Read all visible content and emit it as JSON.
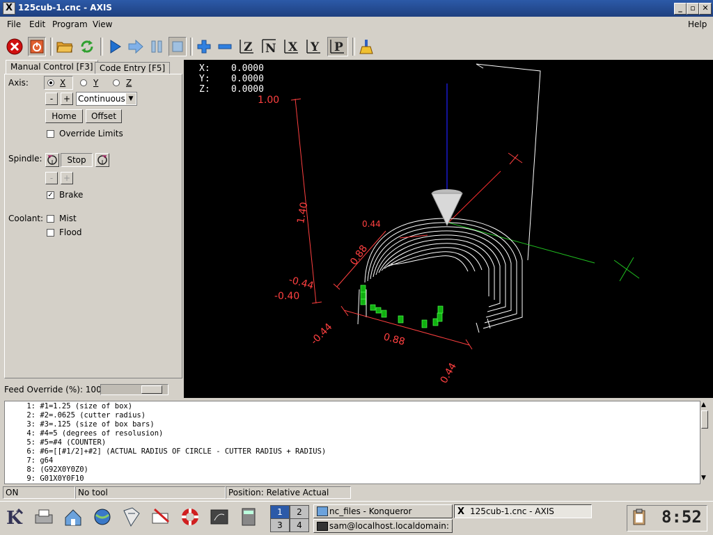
{
  "window": {
    "title": "125cub-1.cnc - AXIS",
    "app_icon": "X"
  },
  "menu": {
    "file": "File",
    "edit": "Edit",
    "program": "Program",
    "view": "View",
    "help": "Help"
  },
  "tabs": {
    "manual": "Manual Control [F3]",
    "code_entry": "Code Entry [F5]"
  },
  "manual": {
    "axis_label": "Axis:",
    "axis_x": "X",
    "axis_y": "Y",
    "axis_z": "Z",
    "minus": "-",
    "plus": "+",
    "jog_mode": "Continuous",
    "home": "Home",
    "offset": "Offset",
    "override_limits": "Override Limits",
    "spindle_label": "Spindle:",
    "stop": "Stop",
    "brake": "Brake",
    "coolant_label": "Coolant:",
    "mist": "Mist",
    "flood": "Flood"
  },
  "feed_override": {
    "label": "Feed Override (%): 100",
    "value": 100
  },
  "dro": {
    "x_label": "X:",
    "x": "0.0000",
    "y_label": "Y:",
    "y": "0.0000",
    "z_label": "Z:",
    "z": "0.0000"
  },
  "dims": {
    "d100": "1.00",
    "d140": "1.40",
    "d044a": "0.44",
    "d088a": "0.88",
    "dm044a": "-0.44",
    "dm040": "-0.40",
    "dm044b": "-0.44",
    "d088b": "0.88",
    "d044b": "0.44",
    "axis_y": "Y"
  },
  "code_lines": [
    {
      "n": "1:",
      "t": "#1=1.25 (size of box)"
    },
    {
      "n": "2:",
      "t": "#2=.0625 (cutter radius)"
    },
    {
      "n": "3:",
      "t": "#3=.125 (size of box bars)"
    },
    {
      "n": "4:",
      "t": "#4=5 (degrees of resolusion)"
    },
    {
      "n": "5:",
      "t": "#5=#4 (COUNTER)"
    },
    {
      "n": "6:",
      "t": "#6=[[#1/2]+#2] (ACTUAL RADIUS OF CIRCLE - CUTTER RADIUS + RADIUS)"
    },
    {
      "n": "7:",
      "t": "g64"
    },
    {
      "n": "8:",
      "t": "(G92X0Y0Z0)"
    },
    {
      "n": "9:",
      "t": "G01X0Y0F10"
    }
  ],
  "status": {
    "machine": "ON",
    "tool": "No tool",
    "position": "Position: Relative Actual"
  },
  "taskbar": {
    "pager": [
      "1",
      "2",
      "3",
      "4"
    ],
    "task1": "nc_files - Konqueror",
    "task2": "sam@localhost.localdomain: /h",
    "task3": "125cub-1.cnc - AXIS",
    "clock": "8:52"
  },
  "colors": {
    "dimension": "#ff4040",
    "toolpath": "#ffffff",
    "feed_moves": "#00cc00",
    "x_axis": "#00ff00",
    "y_axis": "#ff3030",
    "z_axis": "#0000ff"
  }
}
